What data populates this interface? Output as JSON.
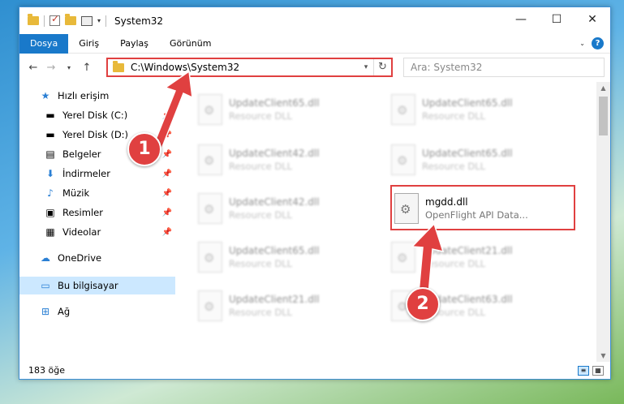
{
  "window": {
    "title": "System32",
    "controls": {
      "minimize": "—",
      "maximize": "☐",
      "close": "✕"
    }
  },
  "ribbon": {
    "tabs": [
      {
        "label": "Dosya",
        "active": true
      },
      {
        "label": "Giriş"
      },
      {
        "label": "Paylaş"
      },
      {
        "label": "Görünüm"
      }
    ]
  },
  "nav": {
    "address": "C:\\Windows\\System32",
    "search_placeholder": "Ara: System32"
  },
  "sidebar": {
    "items": [
      {
        "label": "Hızlı erişim",
        "icon": "star-icon"
      },
      {
        "label": "Yerel Disk (C:)",
        "icon": "drive-icon",
        "pinned": true
      },
      {
        "label": "Yerel Disk (D:)",
        "icon": "drive-icon",
        "pinned": true
      },
      {
        "label": "Belgeler",
        "icon": "documents-icon",
        "pinned": true
      },
      {
        "label": "İndirmeler",
        "icon": "download-icon",
        "pinned": true
      },
      {
        "label": "Müzik",
        "icon": "music-icon",
        "pinned": true
      },
      {
        "label": "Resimler",
        "icon": "pictures-icon",
        "pinned": true
      },
      {
        "label": "Videolar",
        "icon": "videos-icon",
        "pinned": true
      },
      {
        "label": "OneDrive",
        "icon": "cloud-icon"
      },
      {
        "label": "Bu bilgisayar",
        "icon": "computer-icon",
        "selected": true
      },
      {
        "label": "Ağ",
        "icon": "network-icon"
      }
    ]
  },
  "files": [
    {
      "name": "UpdateClient65.dll",
      "desc": "Resource DLL"
    },
    {
      "name": "UpdateClient65.dll",
      "desc": "Resource DLL"
    },
    {
      "name": "UpdateClient42.dll",
      "desc": "Resource DLL"
    },
    {
      "name": "UpdateClient65.dll",
      "desc": "Resource DLL"
    },
    {
      "name": "UpdateClient42.dll",
      "desc": "Resource DLL"
    },
    {
      "name": "mgdd.dll",
      "desc": "OpenFlight API Data..."
    },
    {
      "name": "UpdateClient65.dll",
      "desc": "Resource DLL"
    },
    {
      "name": "UpdateClient21.dll",
      "desc": "Resource DLL"
    },
    {
      "name": "UpdateClient21.dll",
      "desc": "Resource DLL"
    },
    {
      "name": "UpdateClient63.dll",
      "desc": "Resource DLL"
    }
  ],
  "status": {
    "count": "183 öğe"
  },
  "annotations": {
    "step1": "1",
    "step2": "2"
  },
  "colors": {
    "accent": "#1979ca",
    "highlight": "#e04040"
  }
}
